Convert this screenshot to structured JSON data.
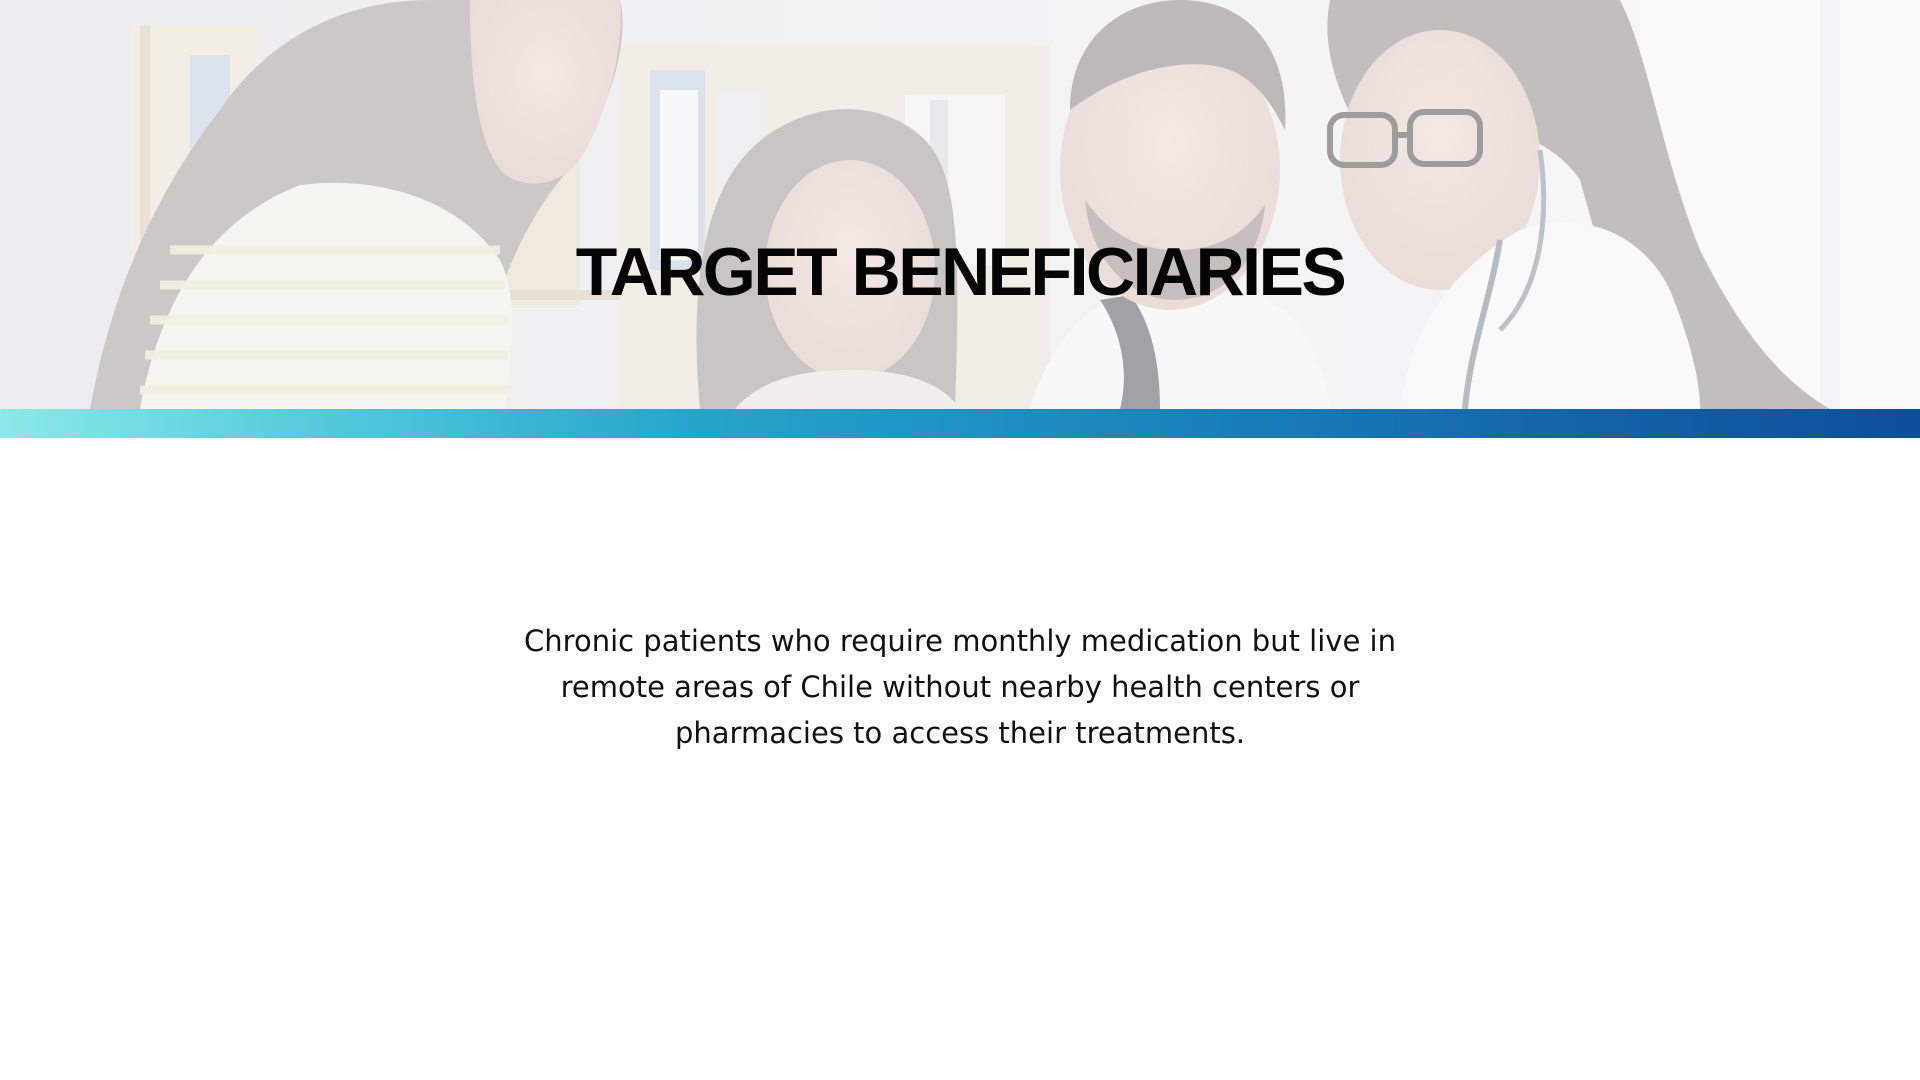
{
  "slide": {
    "title": "TARGET BENEFICIARIES",
    "body": "Chronic patients who require monthly medication but live in remote areas of Chile without nearby health centers or pharmacies to access their treatments."
  },
  "hero_image": {
    "subject": "family-with-doctor-photo"
  },
  "colors": {
    "title_text": "#050505",
    "body_text": "#111111",
    "gradient_start": "#8be9e8",
    "gradient_mid": "#26a7cc",
    "gradient_end": "#0e4e9a",
    "background": "#ffffff"
  }
}
